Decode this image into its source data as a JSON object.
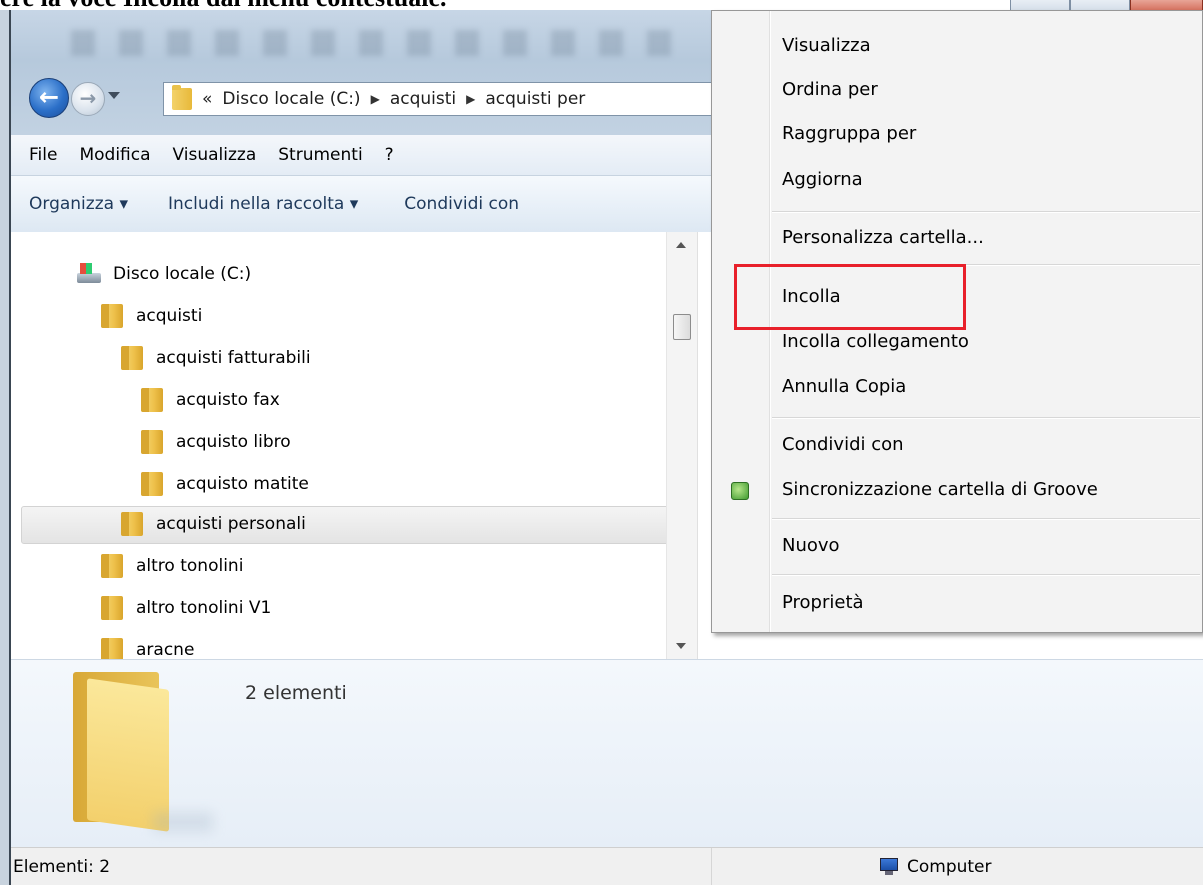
{
  "caption": "ere la voce Incolla dal menu contestuale.",
  "address_bar": {
    "breadcrumbs": [
      "«",
      "Disco locale (C:)",
      "acquisti",
      "acquisti per"
    ]
  },
  "menubar": {
    "items": [
      "File",
      "Modifica",
      "Visualizza",
      "Strumenti",
      "?"
    ]
  },
  "toolbar": {
    "organizza": "Organizza ▾",
    "includi": "Includi nella raccolta ▾",
    "condividi": "Condividi con"
  },
  "tree": {
    "items": [
      {
        "label": "Disco locale (C:)",
        "icon": "drive-icon"
      },
      {
        "label": "acquisti",
        "icon": "folder-icon"
      },
      {
        "label": "acquisti fatturabili",
        "icon": "folder-icon"
      },
      {
        "label": "acquisto fax",
        "icon": "folder-icon"
      },
      {
        "label": "acquisto libro",
        "icon": "folder-icon"
      },
      {
        "label": "acquisto matite",
        "icon": "folder-icon"
      },
      {
        "label": "acquisti personali",
        "icon": "folder-icon",
        "selected": true
      },
      {
        "label": "altro tonolini",
        "icon": "folder-icon"
      },
      {
        "label": "altro tonolini V1",
        "icon": "folder-icon"
      },
      {
        "label": "aracne",
        "icon": "folder-icon"
      }
    ]
  },
  "details": {
    "count": "2 elementi"
  },
  "statusbar": {
    "left": "Elementi: 2",
    "right": "Computer"
  },
  "context_menu": {
    "items": [
      {
        "label": "Visualizza"
      },
      {
        "label": "Ordina per"
      },
      {
        "label": "Raggruppa per"
      },
      {
        "label": "Aggiorna"
      },
      {
        "label": "Personalizza cartella..."
      },
      {
        "label": "Incolla",
        "highlighted": true
      },
      {
        "label": "Incolla collegamento"
      },
      {
        "label": "Annulla Copia"
      },
      {
        "label": "Condividi con"
      },
      {
        "label": "Sincronizzazione cartella di Groove",
        "icon": "groove-sync-icon"
      },
      {
        "label": "Nuovo"
      },
      {
        "label": "Proprietà"
      }
    ]
  },
  "colors": {
    "highlight_border": "#e8202a",
    "address_bg": "#c2d2e2",
    "menu_bg": "#f3f3f3"
  }
}
